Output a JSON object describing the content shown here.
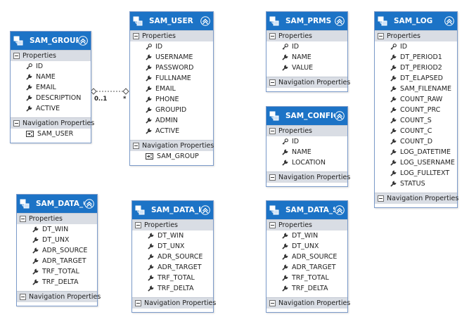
{
  "section_labels": {
    "properties": "Properties",
    "navigation": "Navigation Properties"
  },
  "colors": {
    "header": "#1c73c6",
    "section": "#d9dde4",
    "border": "#7b9ac9"
  },
  "icons": {
    "entity": "entity-icon",
    "collapse": "collapse-chevron-icon",
    "key": "key-icon",
    "property": "wrench-icon",
    "navigation": "navigation-property-icon"
  },
  "entities": {
    "sam_group": {
      "name": "SAM_GROUP",
      "properties": [
        "ID",
        "NAME",
        "EMAIL",
        "DESCRIPTION",
        "ACTIVE"
      ],
      "navigation": [
        "SAM_USER"
      ]
    },
    "sam_user": {
      "name": "SAM_USER",
      "properties": [
        "ID",
        "USERNAME",
        "PASSWORD",
        "FULLNAME",
        "EMAIL",
        "PHONE",
        "GROUPID",
        "ADMIN",
        "ACTIVE"
      ],
      "navigation": [
        "SAM_GROUP"
      ]
    },
    "sam_prms": {
      "name": "SAM_PRMS",
      "properties": [
        "ID",
        "NAME",
        "VALUE"
      ],
      "navigation": []
    },
    "sam_config": {
      "name": "SAM_CONFIG",
      "properties": [
        "ID",
        "NAME",
        "LOCATION"
      ],
      "navigation": []
    },
    "sam_log": {
      "name": "SAM_LOG",
      "properties": [
        "ID",
        "DT_PERIOD1",
        "DT_PERIOD2",
        "DT_ELAPSED",
        "SAM_FILENAME",
        "COUNT_RAW",
        "COUNT_PRC",
        "COUNT_S",
        "COUNT_C",
        "COUNT_D",
        "LOG_DATETIME",
        "LOG_USERNAME",
        "LOG_FULLTEXT",
        "STATUS"
      ],
      "navigation": []
    },
    "sam_data_c": {
      "name": "SAM_DATA_C",
      "properties": [
        "DT_WIN",
        "DT_UNX",
        "ADR_SOURCE",
        "ADR_TARGET",
        "TRF_TOTAL",
        "TRF_DELTA"
      ],
      "navigation": []
    },
    "sam_data_d": {
      "name": "SAM_DATA_D",
      "properties": [
        "DT_WIN",
        "DT_UNX",
        "ADR_SOURCE",
        "ADR_TARGET",
        "TRF_TOTAL",
        "TRF_DELTA"
      ],
      "navigation": []
    },
    "sam_data_s": {
      "name": "SAM_DATA_S",
      "properties": [
        "DT_WIN",
        "DT_UNX",
        "ADR_SOURCE",
        "ADR_TARGET",
        "TRF_TOTAL",
        "TRF_DELTA"
      ],
      "navigation": []
    }
  },
  "association": {
    "from": "SAM_GROUP",
    "to": "SAM_USER",
    "from_multiplicity": "0..1",
    "to_multiplicity": "*"
  }
}
